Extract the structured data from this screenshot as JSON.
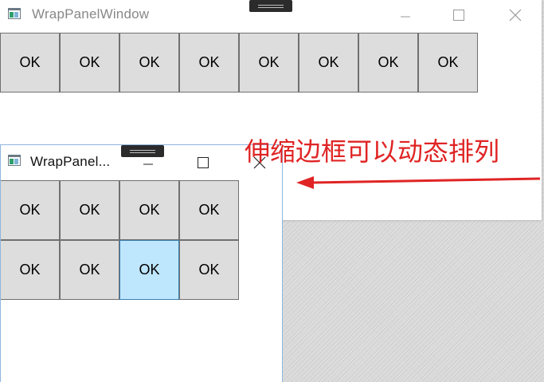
{
  "back_window": {
    "title": "WrapPanelWindow",
    "buttons": [
      "OK",
      "OK",
      "OK",
      "OK",
      "OK",
      "OK",
      "OK",
      "OK"
    ]
  },
  "front_window": {
    "title": "WrapPanel...",
    "buttons": [
      "OK",
      "OK",
      "OK",
      "OK",
      "OK",
      "OK",
      "OK",
      "OK"
    ],
    "hovered_index": 6
  },
  "annotation": {
    "text": "伸缩边框可以动态排列",
    "color": "#e02424"
  },
  "icons": {
    "minimize": "minimize-icon",
    "maximize": "maximize-icon",
    "close": "close-icon",
    "app": "app-window-icon"
  }
}
